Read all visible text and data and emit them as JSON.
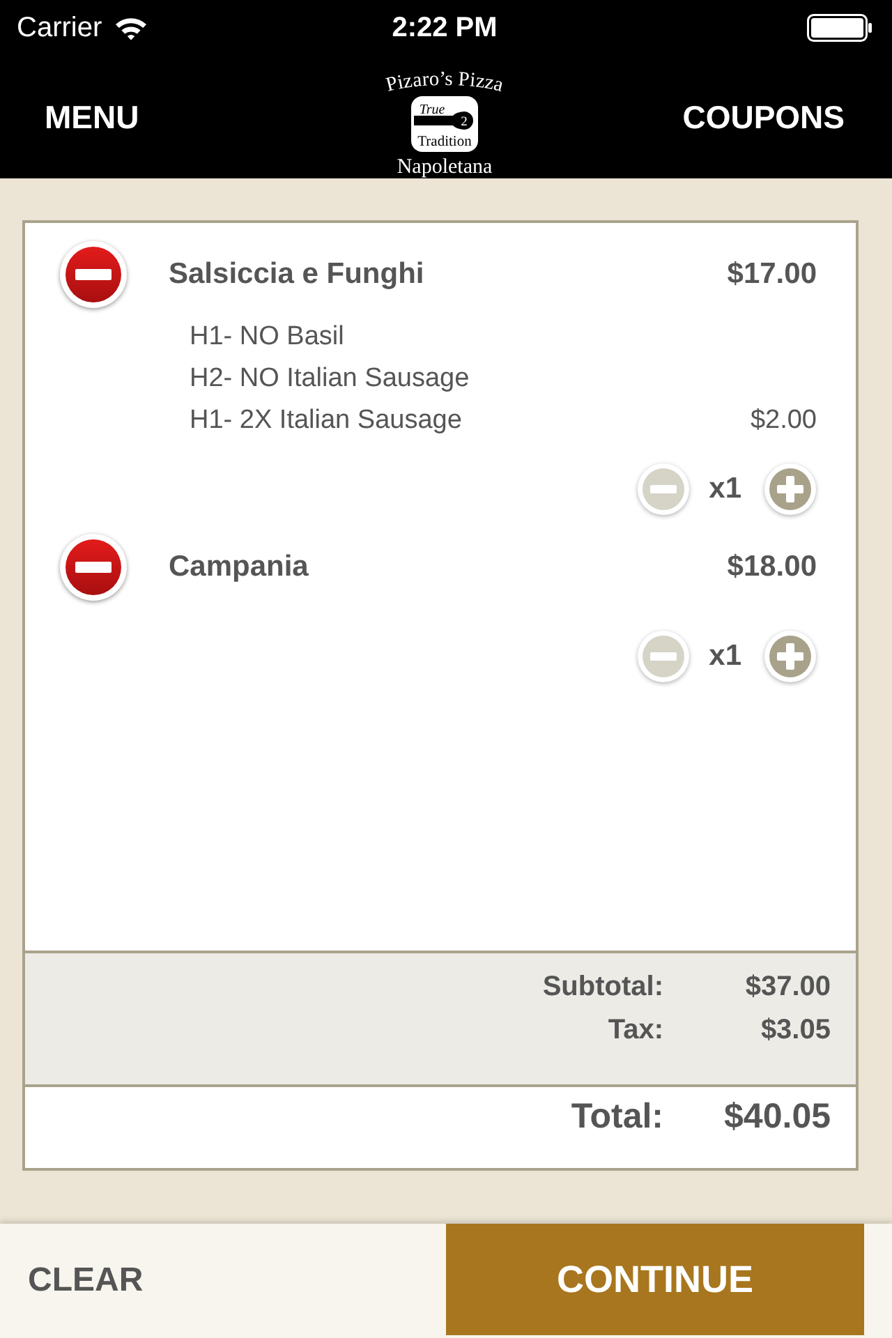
{
  "status_bar": {
    "carrier": "Carrier",
    "time": "2:22 PM"
  },
  "nav": {
    "left": "MENU",
    "right": "COUPONS",
    "logo": {
      "arc": "Pizaro’s Pizza",
      "badge_top": "True",
      "badge_number": "2",
      "badge_bottom": "Tradition",
      "bottom": "Napoletana"
    }
  },
  "items": [
    {
      "name": "Salsiccia e Funghi",
      "price": "$17.00",
      "modifiers": [
        {
          "text": "H1- NO Basil"
        },
        {
          "text": "H2- NO Italian Sausage"
        },
        {
          "text": "H1- 2X Italian Sausage",
          "price": "$2.00"
        }
      ],
      "quantity": "x1",
      "decrease_disabled": true
    },
    {
      "name": "Campania",
      "price": "$18.00",
      "quantity": "x1",
      "decrease_disabled": true
    }
  ],
  "summary": [
    {
      "label": "Subtotal:",
      "value": "$37.00"
    },
    {
      "label": "Tax:",
      "value": "$3.05"
    }
  ],
  "total": {
    "label": "Total:",
    "value": "$40.05"
  },
  "buttons": {
    "clear": "CLEAR",
    "continue": "CONTINUE"
  }
}
